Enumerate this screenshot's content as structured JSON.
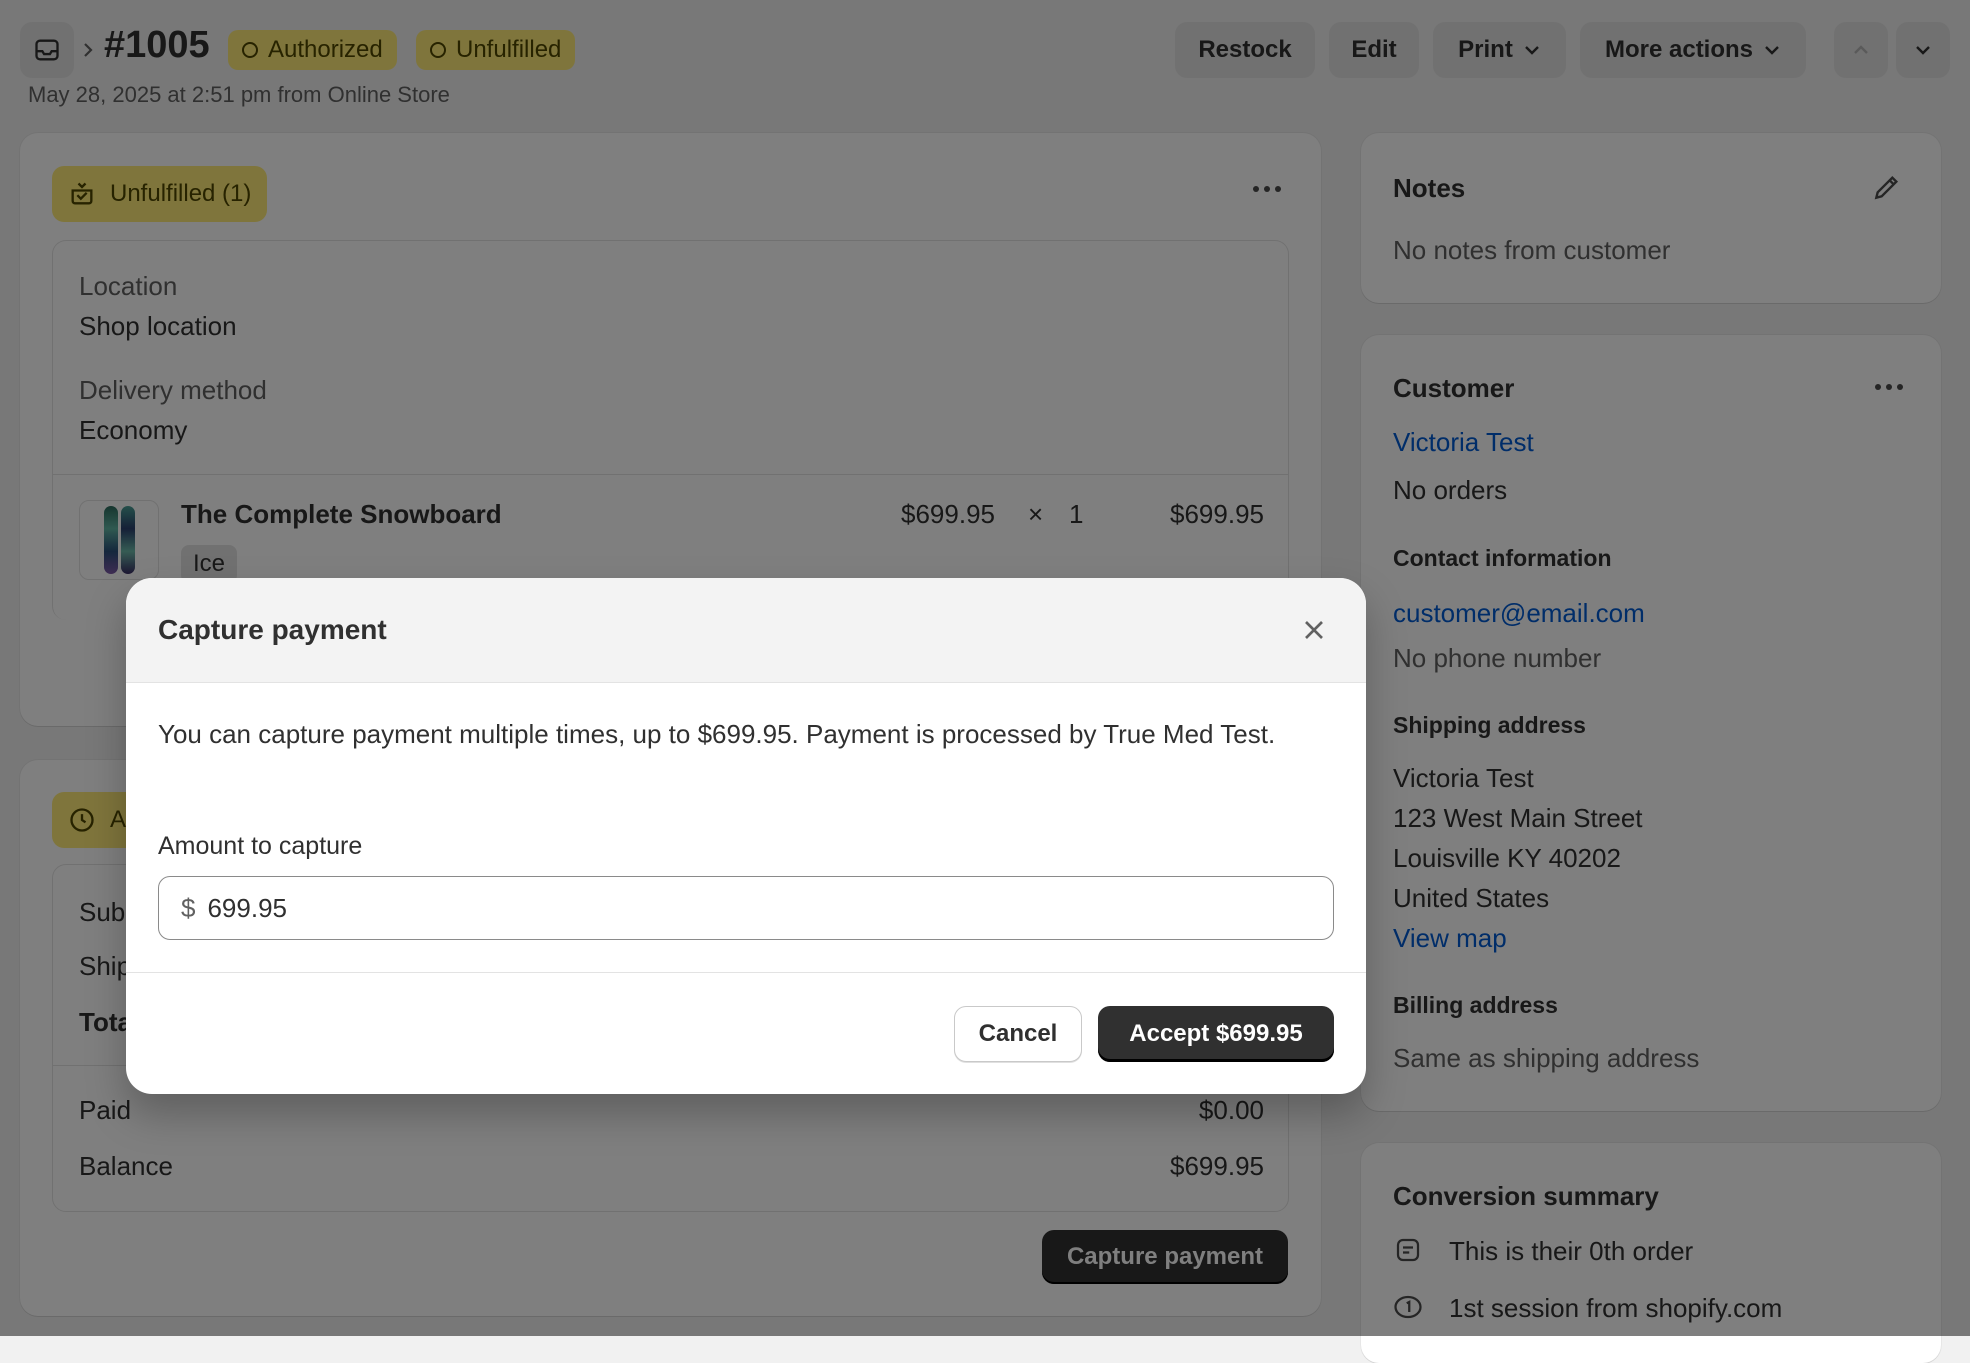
{
  "header": {
    "order_number": "#1005",
    "badges": [
      "Authorized",
      "Unfulfilled"
    ],
    "subtitle": "May 28, 2025 at 2:51 pm from Online Store",
    "actions": {
      "restock": "Restock",
      "edit": "Edit",
      "print": "Print",
      "more": "More actions"
    }
  },
  "fulfillment": {
    "badge": "Unfulfilled (1)",
    "location_label": "Location",
    "location_value": "Shop location",
    "delivery_label": "Delivery method",
    "delivery_value": "Economy",
    "product": {
      "name": "The Complete Snowboard",
      "variant": "Ice",
      "price": "$699.95",
      "times": "×",
      "qty": "1",
      "total": "$699.95"
    }
  },
  "payment": {
    "badge_partial": "A",
    "rows_partial": [
      "Sub",
      "Ship",
      "Tota"
    ],
    "paid_label": "Paid",
    "paid_value": "$0.00",
    "balance_label": "Balance",
    "balance_value": "$699.95",
    "capture_button": "Capture payment"
  },
  "notes": {
    "title": "Notes",
    "text": "No notes from customer"
  },
  "customer": {
    "title": "Customer",
    "name": "Victoria Test",
    "orders": "No orders",
    "contact_title": "Contact information",
    "email": "customer@email.com",
    "phone": "No phone number",
    "shipping_title": "Shipping address",
    "address": [
      "Victoria Test",
      "123 West Main Street",
      "Louisville KY 40202",
      "United States"
    ],
    "view_map": "View map",
    "billing_title": "Billing address",
    "billing_text": "Same as shipping address"
  },
  "conversion": {
    "title": "Conversion summary",
    "items": [
      "This is their 0th order",
      "1st session from shopify.com"
    ]
  },
  "modal": {
    "title": "Capture payment",
    "description": "You can capture payment multiple times, up to $699.95. Payment is processed by True Med Test.",
    "amount_label": "Amount to capture",
    "currency": "$",
    "amount_value": "699.95",
    "cancel": "Cancel",
    "accept": "Accept $699.95"
  },
  "colors": {
    "badge_yellow": "#ffeb78",
    "link_blue": "#005bd3",
    "primary_dark": "#303030"
  }
}
